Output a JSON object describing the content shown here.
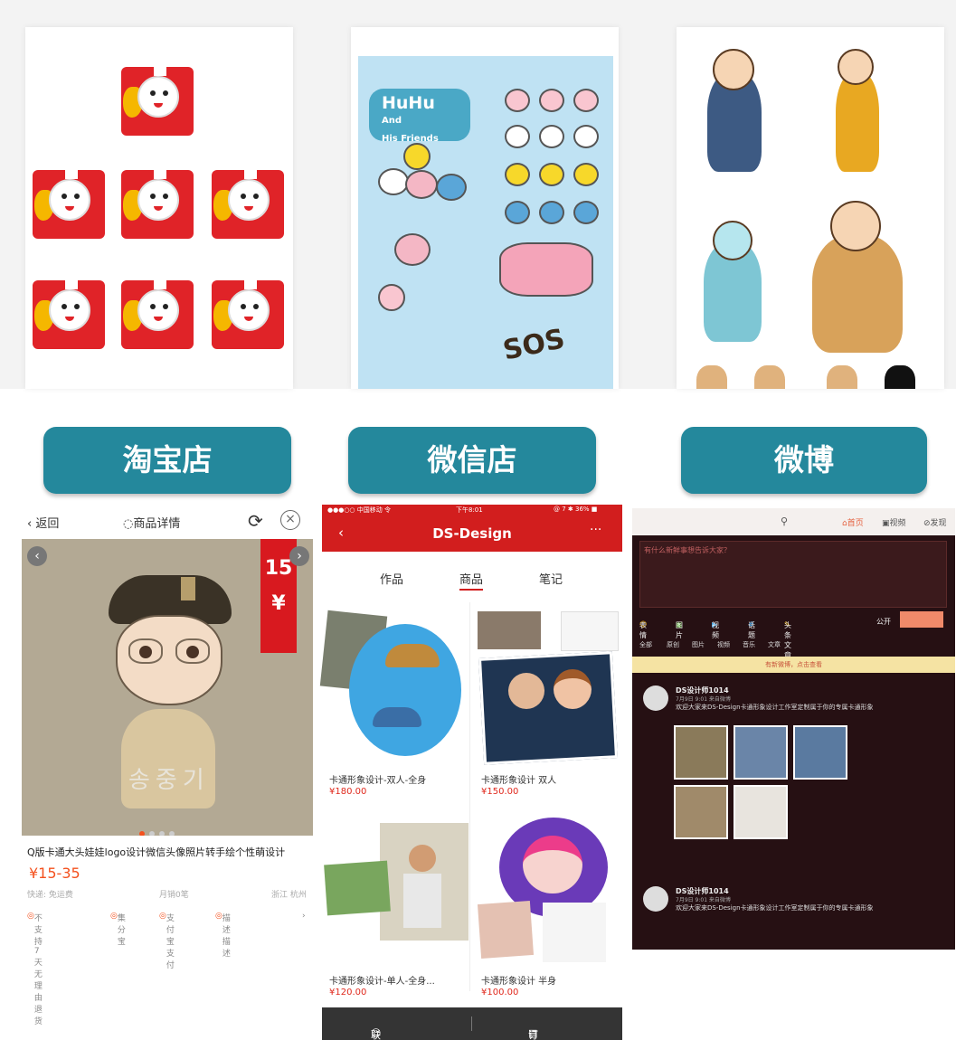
{
  "buttons": {
    "taobao": "淘宝店",
    "wechat": "微信店",
    "weibo": "微博"
  },
  "huhu": {
    "title": "HuHu",
    "and": "And",
    "friends": "His Friends",
    "sos": "SOS"
  },
  "taobao": {
    "back": "返回",
    "title": "商品详情",
    "close": "×",
    "tag_number": "15",
    "tag_currency": "¥",
    "name_overlay": "송중기",
    "description": "Q版卡通大头娃娃logo设计微信头像照片转手绘个性萌设计",
    "price": "¥15-35",
    "meta": {
      "shipping": "快递: 免运费",
      "sales": "月销0笔",
      "location": "浙江 杭州"
    },
    "services": [
      "不支持7天无理由退货",
      "集分宝",
      "支付宝支付",
      "描述描述"
    ]
  },
  "wechat": {
    "status_carrier": "●●●○○ 中国移动 令",
    "status_time": "下午8:01",
    "status_battery": "@ 7 ✱ 36% ■",
    "title": "DS-Design",
    "back": "‹",
    "more": "···",
    "tabs": [
      "作品",
      "商品",
      "笔记"
    ],
    "active_tab": 1,
    "products": [
      {
        "label": "卡通形象设计-双人-全身",
        "price": "¥180.00"
      },
      {
        "label": "卡通形象设计 双人",
        "price": "¥150.00"
      },
      {
        "label": "卡通形象设计-单人-全身...",
        "price": "¥120.00"
      },
      {
        "label": "卡通形象设计 半身",
        "price": "¥100.00"
      }
    ],
    "footer": {
      "contact": "联系TA",
      "orders": "订单"
    }
  },
  "weibo": {
    "search_icon": "search-icon",
    "nav": [
      "首页",
      "视频",
      "发现"
    ],
    "compose_hint": "有什么新鲜事想告诉大家？",
    "tools": [
      "表情",
      "图片",
      "视频",
      "话题",
      "头条文章"
    ],
    "publish": "公开",
    "filters": [
      "全部",
      "原创",
      "图片",
      "视频",
      "音乐",
      "文章"
    ],
    "notice": "有新微博，点击查看",
    "posts": [
      {
        "name": "DS设计师1014",
        "time": "7月9日 9:01 来自微博",
        "text": "欢迎大家来DS-Design卡通形象设计工作室定制属于你的专属卡通形象"
      },
      {
        "name": "DS设计师1014",
        "time": "7月9日 9:01 来自微博",
        "text": "欢迎大家来DS-Design卡通形象设计工作室定制属于你的专属卡通形象"
      }
    ]
  },
  "colors": {
    "button_teal": "#24889c",
    "taobao_orange": "#f4511e",
    "wechat_red": "#d21e1e",
    "weibo_dark": "#261013"
  }
}
